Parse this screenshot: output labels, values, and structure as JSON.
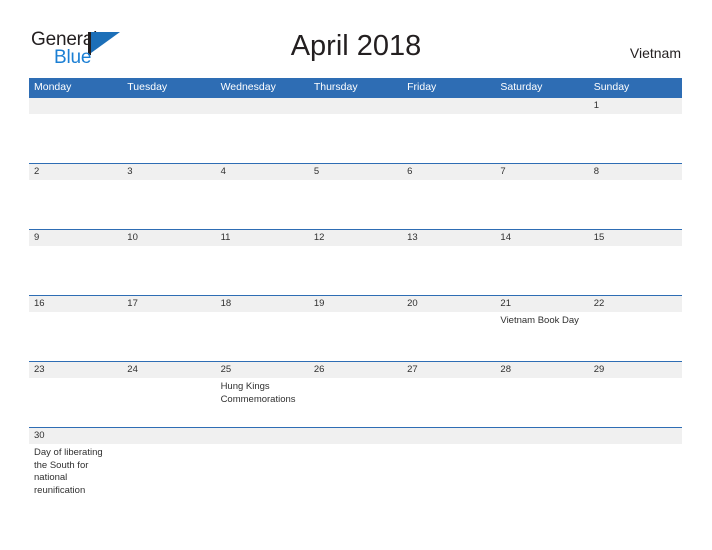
{
  "brand": {
    "name_part1": "General",
    "name_part2": "Blue",
    "logo_icon": "flag-triangle-icon"
  },
  "header": {
    "title": "April 2018",
    "region": "Vietnam"
  },
  "calendar": {
    "weekdays": [
      "Monday",
      "Tuesday",
      "Wednesday",
      "Thursday",
      "Friday",
      "Saturday",
      "Sunday"
    ],
    "accent_color": "#2e6db4",
    "date_band_color": "#f0f0f0",
    "weeks": [
      {
        "dates": [
          "",
          "",
          "",
          "",
          "",
          "",
          "1"
        ],
        "events": [
          "",
          "",
          "",
          "",
          "",
          "",
          ""
        ]
      },
      {
        "dates": [
          "2",
          "3",
          "4",
          "5",
          "6",
          "7",
          "8"
        ],
        "events": [
          "",
          "",
          "",
          "",
          "",
          "",
          ""
        ]
      },
      {
        "dates": [
          "9",
          "10",
          "11",
          "12",
          "13",
          "14",
          "15"
        ],
        "events": [
          "",
          "",
          "",
          "",
          "",
          "",
          ""
        ]
      },
      {
        "dates": [
          "16",
          "17",
          "18",
          "19",
          "20",
          "21",
          "22"
        ],
        "events": [
          "",
          "",
          "",
          "",
          "",
          "Vietnam Book Day",
          ""
        ]
      },
      {
        "dates": [
          "23",
          "24",
          "25",
          "26",
          "27",
          "28",
          "29"
        ],
        "events": [
          "",
          "",
          "Hung Kings Commemorations",
          "",
          "",
          "",
          ""
        ]
      },
      {
        "dates": [
          "30",
          "",
          "",
          "",
          "",
          "",
          ""
        ],
        "events": [
          "Day of liberating the South for national reunification",
          "",
          "",
          "",
          "",
          "",
          ""
        ]
      }
    ]
  }
}
